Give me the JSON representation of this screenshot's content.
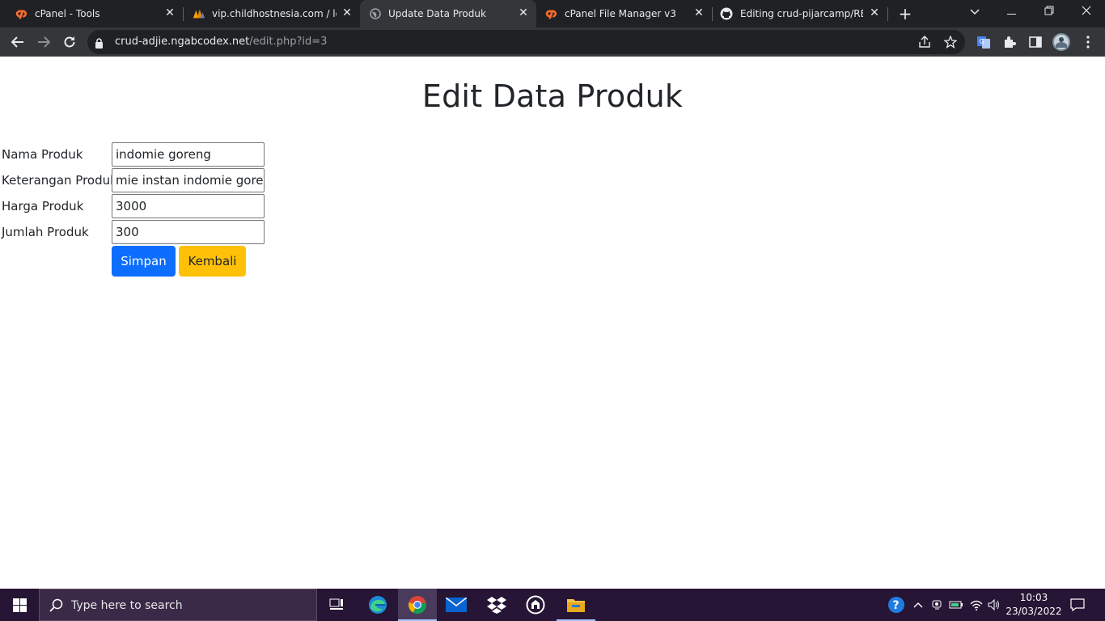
{
  "browser": {
    "tabs": [
      {
        "title": "cPanel - Tools",
        "favicon": "cpanel-icon"
      },
      {
        "title": "vip.childhostnesia.com / loca",
        "favicon": "phpmyadmin-icon"
      },
      {
        "title": "Update Data Produk",
        "favicon": "globe-icon"
      },
      {
        "title": "cPanel File Manager v3",
        "favicon": "cpanel-icon"
      },
      {
        "title": "Editing crud-pijarcamp/READ",
        "favicon": "github-icon"
      }
    ],
    "url_host": "crud-adjie.ngabcodex.net",
    "url_path": "/edit.php?id=3"
  },
  "page": {
    "title": "Edit Data Produk",
    "form": {
      "fields": [
        {
          "label": "Nama Produk",
          "value": "indomie goreng"
        },
        {
          "label": "Keterangan Produk",
          "value": "mie instan indomie goreng"
        },
        {
          "label": "Harga Produk",
          "value": "3000"
        },
        {
          "label": "Jumlah Produk",
          "value": "300"
        }
      ],
      "save_label": "Simpan",
      "back_label": "Kembali"
    }
  },
  "taskbar": {
    "search_placeholder": "Type here to search",
    "time": "10:03",
    "date": "23/03/2022"
  },
  "colors": {
    "primary": "#0d6efd",
    "warning": "#ffc107",
    "tabstrip": "#202124",
    "toolbar": "#35363a",
    "taskbar": "#261534"
  }
}
